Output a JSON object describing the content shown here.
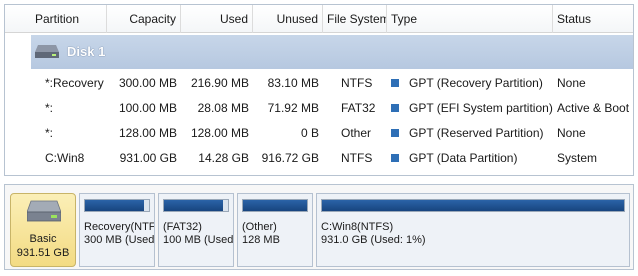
{
  "columns": {
    "partition": "Partition",
    "capacity": "Capacity",
    "used": "Used",
    "unused": "Unused",
    "file_system": "File System",
    "type": "Type",
    "status": "Status"
  },
  "disk": {
    "label": "Disk 1"
  },
  "rows": [
    {
      "partition": "*:Recovery",
      "capacity": "300.00 MB",
      "used": "216.90 MB",
      "unused": "83.10 MB",
      "fs": "NTFS",
      "type": "GPT (Recovery Partition)",
      "status": "None"
    },
    {
      "partition": "*:",
      "capacity": "100.00 MB",
      "used": "28.08 MB",
      "unused": "71.92 MB",
      "fs": "FAT32",
      "type": "GPT (EFI System partition)",
      "status": "Active & Boot"
    },
    {
      "partition": "*:",
      "capacity": "128.00 MB",
      "used": "128.00 MB",
      "unused": "0 B",
      "fs": "Other",
      "type": "GPT (Reserved Partition)",
      "status": "None"
    },
    {
      "partition": "C:Win8",
      "capacity": "931.00 GB",
      "used": "14.28 GB",
      "unused": "916.72 GB",
      "fs": "NTFS",
      "type": "GPT (Data Partition)",
      "status": "System"
    }
  ],
  "disk_map": {
    "disk_type": "Basic",
    "disk_size": "931.51 GB",
    "partitions": [
      {
        "line1": "Recovery(NTF",
        "line2": "300 MB (Used:",
        "used_fraction": 0.72
      },
      {
        "line1": "(FAT32)",
        "line2": "100 MB (Used:",
        "used_fraction": 0.28
      },
      {
        "line1": "(Other)",
        "line2": "128 MB",
        "used_fraction": 1.0
      },
      {
        "line1": "C:Win8(NTFS)",
        "line2": "931.0 GB (Used: 1%)",
        "used_fraction": 0.01
      }
    ]
  },
  "colors": {
    "type_marker": "#2e6fb6",
    "bar_fill": "#1f58a0",
    "disk_header": "#b6c8e0"
  }
}
